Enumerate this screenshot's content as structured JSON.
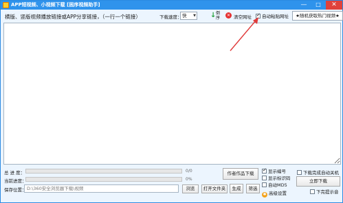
{
  "window": {
    "title": "APP短视频、小视频下载 [困序视频助手]",
    "controls": {
      "minimize": "—",
      "maximize": "□",
      "close": "✕"
    }
  },
  "toolbar": {
    "hint": "横版、竖版视频播放链接或APP分享链接，（一行一个链接）",
    "speed_label": "下载速度：",
    "speed_value": "快",
    "sort_label": "倒序",
    "clear_label": "清空网址",
    "auto_paste_label": "自动粘贴网址",
    "auto_paste_checked": true,
    "hot_button_label": "★随机获取热门视频★"
  },
  "links_input": {
    "value": ""
  },
  "bottom": {
    "total_progress_label": "总 进 度：",
    "total_progress_text": "0/0",
    "total_progress_fraction": 0,
    "current_progress_label": "当前进度：",
    "current_progress_text": "0%",
    "current_progress_fraction": 0,
    "save_label": "保存位置：",
    "save_path": "D:\\360安全浏览器下载\\视频",
    "browse_label": "浏览",
    "open_folder_label": "打开文件夹",
    "generate_label": "生成",
    "select_label": "筛选",
    "author_download_label": "作者作品下载",
    "options": [
      {
        "label": "显示编号",
        "checked": true
      },
      {
        "label": "显示标识码",
        "checked": false
      },
      {
        "label": "自动MD5",
        "checked": false
      }
    ],
    "advanced_label": "高级设置",
    "shutdown_label": "下载完成自动关机",
    "shutdown_checked": false,
    "download_now_label": "立即下载",
    "sound_label": "下完提示音",
    "sound_checked": false
  }
}
